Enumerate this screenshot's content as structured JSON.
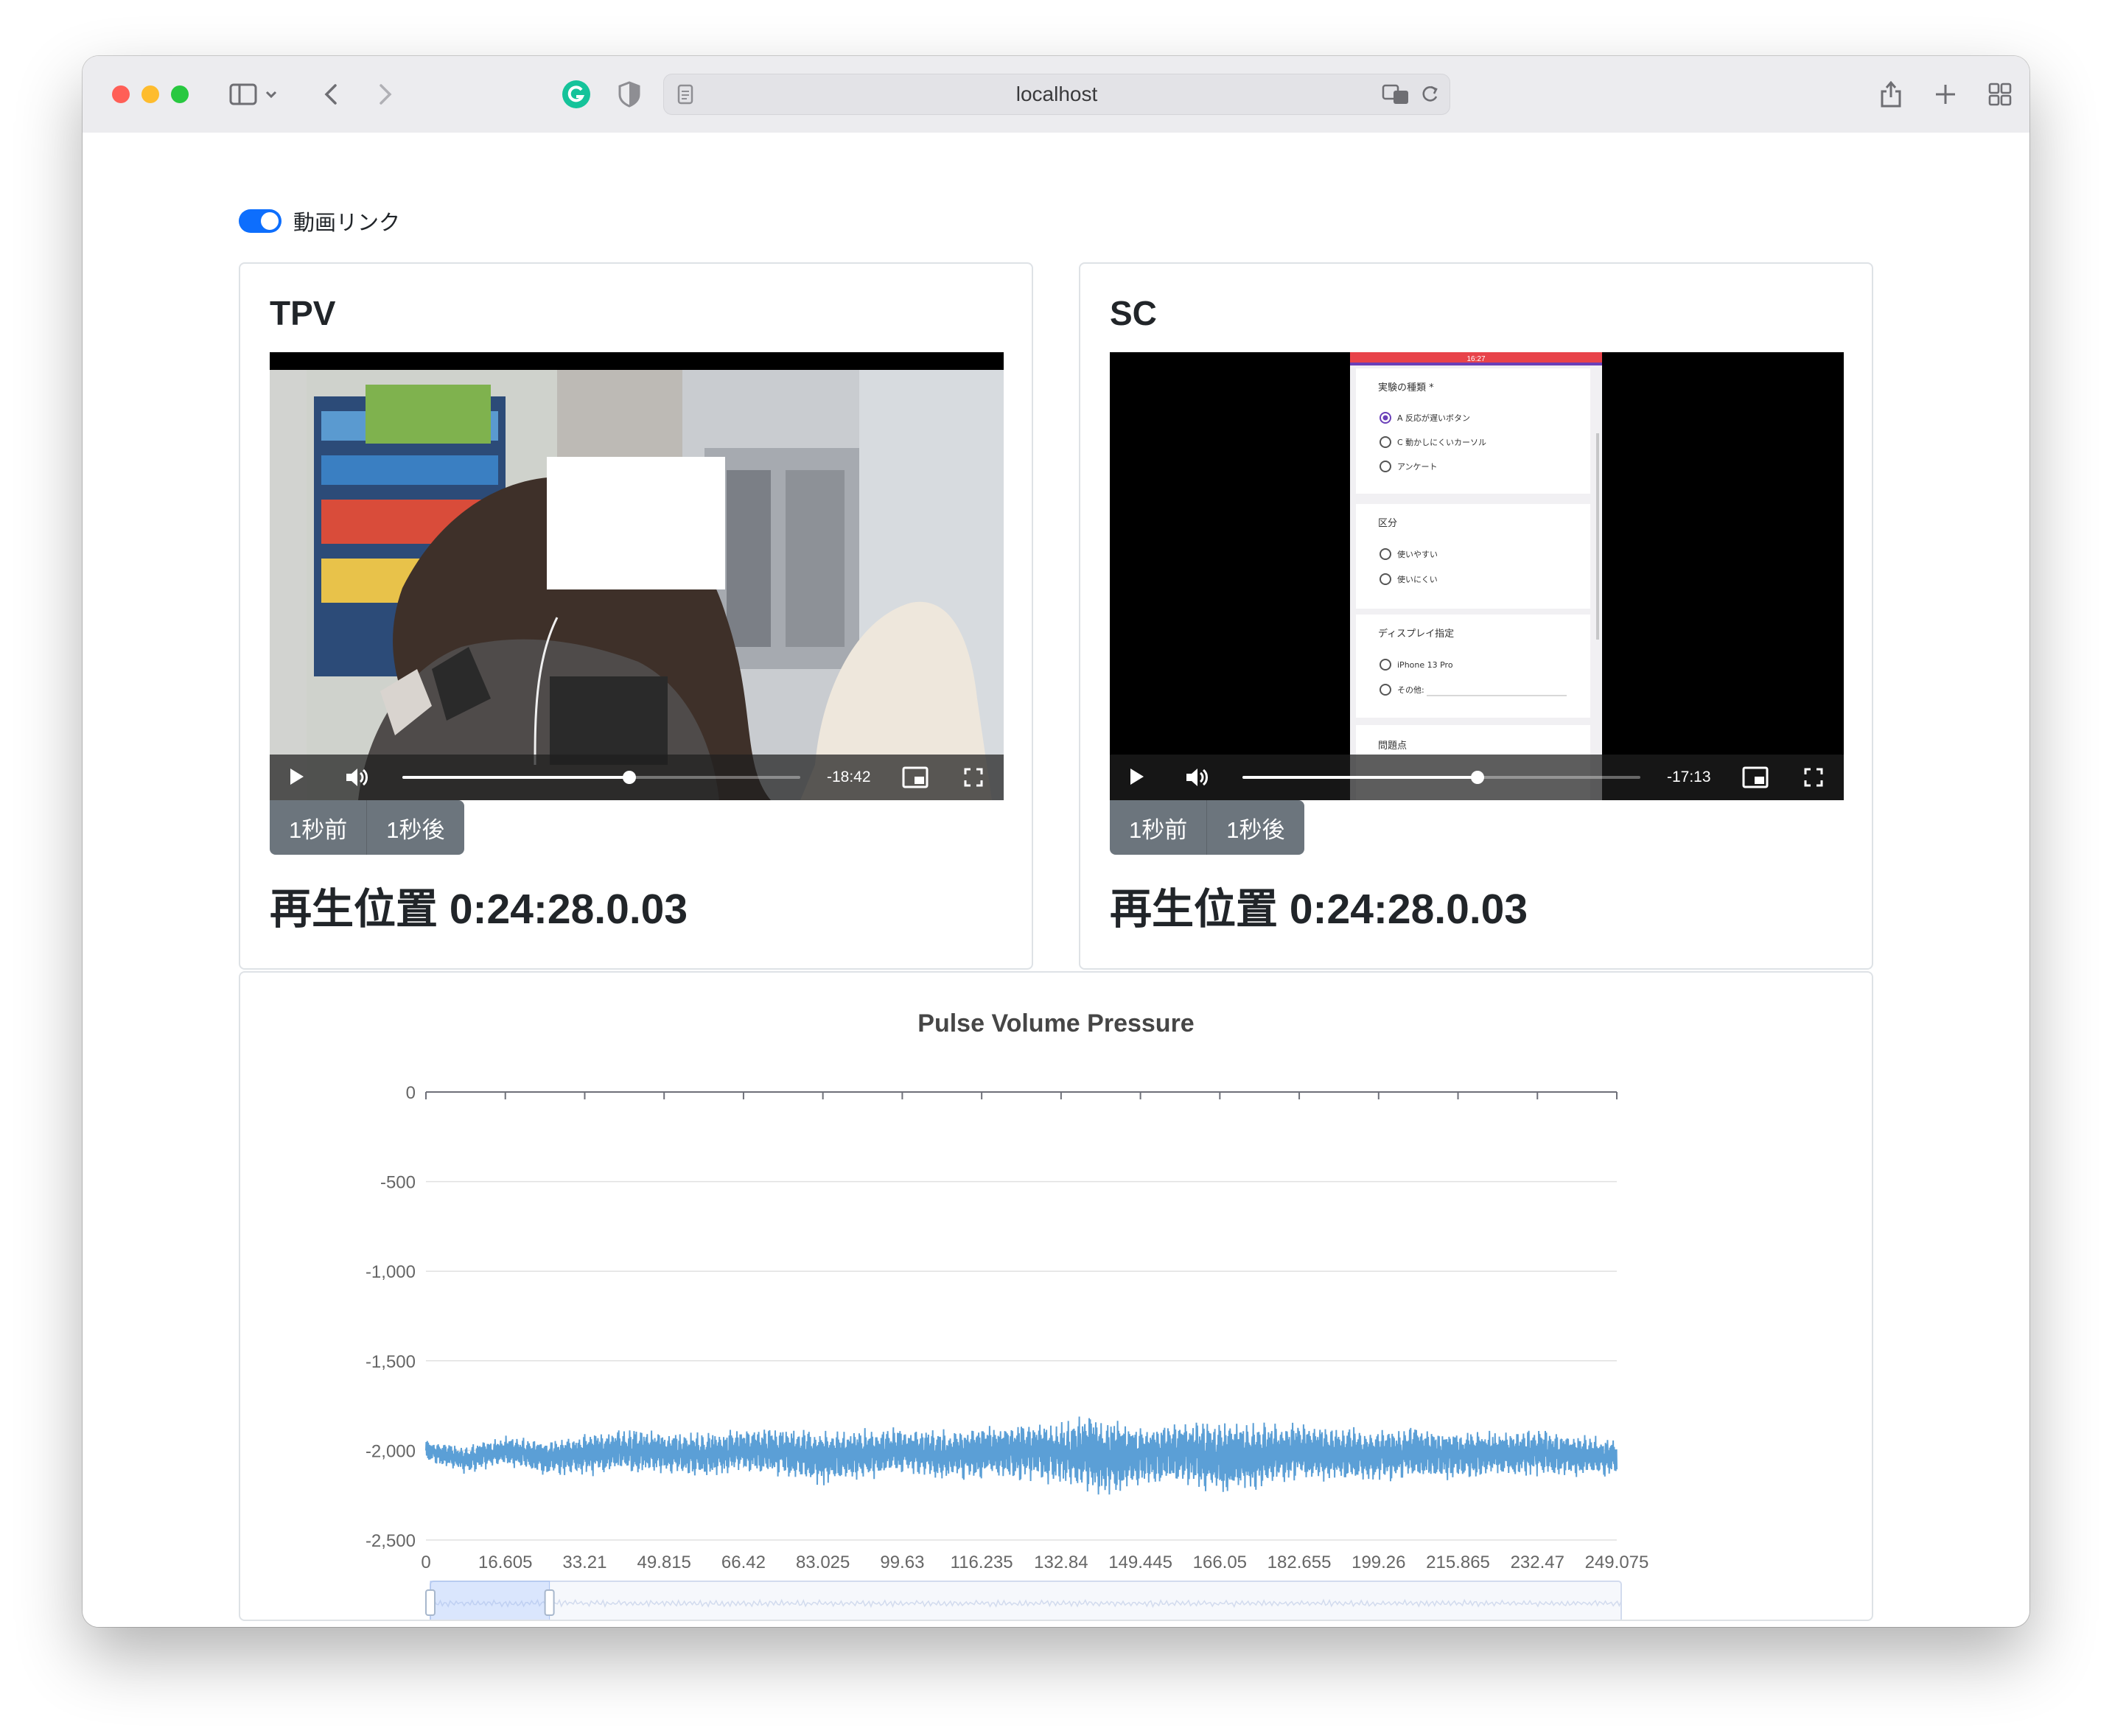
{
  "browser": {
    "url": "localhost"
  },
  "toggle": {
    "label": "動画リンク",
    "checked": true
  },
  "videos": [
    {
      "title": "TPV",
      "remaining_time": "-18:42",
      "progress_fraction": 0.57,
      "back_label": "1秒前",
      "forward_label": "1秒後",
      "position_label": "再生位置 0:24:28.0.03"
    },
    {
      "title": "SC",
      "remaining_time": "-17:13",
      "progress_fraction": 0.59,
      "back_label": "1秒前",
      "forward_label": "1秒後",
      "position_label": "再生位置 0:24:28.0.03",
      "screen": {
        "status_time": "16:27",
        "q1_title": "実験の種類 *",
        "q1_options": [
          "A 反応が遅いボタン",
          "C 動かしにくいカーソル",
          "アンケート"
        ],
        "q2_title": "区分",
        "q2_options": [
          "使いやすい",
          "使いにくい"
        ],
        "q3_title": "ディスプレイ指定",
        "q3_options": [
          "iPhone 13 Pro",
          "その他:"
        ],
        "q4_title": "問題点"
      }
    }
  ],
  "chart_data": {
    "type": "line",
    "title": "Pulse Volume Pressure",
    "xlabel": "",
    "ylabel": "",
    "x_ticks": [
      "0",
      "16.605",
      "33.21",
      "49.815",
      "66.42",
      "83.025",
      "99.63",
      "116.235",
      "132.84",
      "149.445",
      "166.05",
      "182.655",
      "199.26",
      "215.865",
      "232.47",
      "249.075"
    ],
    "y_ticks": [
      "0",
      "-500",
      "-1,000",
      "-1,500",
      "-2,000",
      "-2,500"
    ],
    "xlim": [
      0,
      249.075
    ],
    "ylim": [
      -2500,
      0
    ],
    "grid": true,
    "color": "#5b9fd6",
    "series": [
      {
        "x": [
          0,
          8,
          16.6,
          25,
          33.2,
          41,
          49.8,
          58,
          66.4,
          75,
          83,
          91,
          99.6,
          108,
          116.2,
          124,
          132.8,
          138.5,
          141,
          149.4,
          158,
          166,
          174,
          182.7,
          191,
          199.3,
          207,
          215.9,
          224,
          232.5,
          240,
          249.075
        ],
        "center": [
          -2000,
          -2050,
          -2000,
          -2040,
          -2020,
          -2000,
          -2010,
          -2030,
          -2000,
          -2010,
          -2040,
          -2020,
          -2000,
          -2030,
          -2010,
          -2000,
          -2020,
          -2010,
          -2040,
          -2030,
          -2010,
          -2040,
          -2030,
          -2010,
          -2020,
          -2030,
          -2010,
          -2030,
          -2020,
          -2010,
          -2030,
          -2040
        ],
        "amplitude": [
          60,
          70,
          80,
          90,
          110,
          120,
          110,
          120,
          110,
          130,
          140,
          130,
          120,
          130,
          140,
          150,
          160,
          200,
          230,
          150,
          160,
          190,
          180,
          150,
          140,
          130,
          140,
          130,
          120,
          120,
          110,
          100
        ]
      }
    ],
    "zoom_window": [
      0,
      0.1
    ]
  }
}
